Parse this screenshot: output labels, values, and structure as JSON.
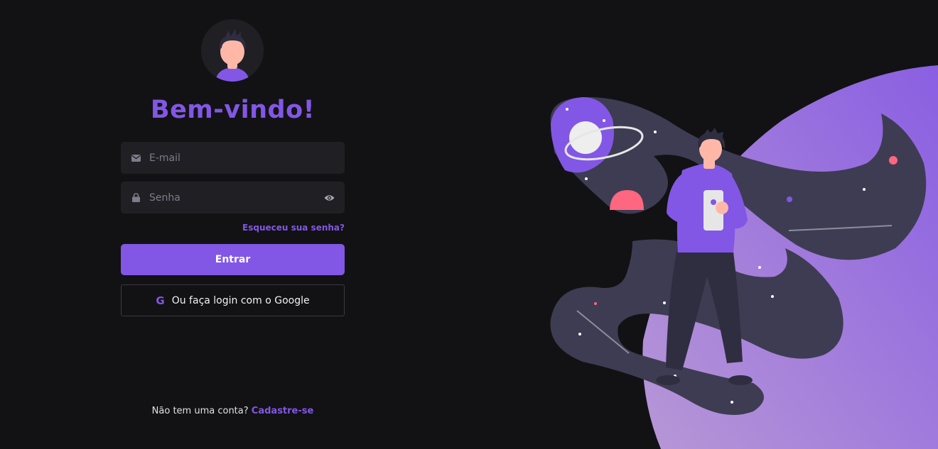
{
  "header": {
    "title": "Bem-vindo!"
  },
  "form": {
    "email": {
      "placeholder": "E-mail",
      "value": ""
    },
    "password": {
      "placeholder": "Senha",
      "value": ""
    },
    "forgot_link": "Esqueceu sua senha?",
    "submit_label": "Entrar",
    "google_label": "Ou faça login com o Google",
    "google_glyph": "G"
  },
  "footer": {
    "prompt": "Não tem uma conta?",
    "signup_link": "Cadastre-se"
  },
  "icons": {
    "email": "envelope-icon",
    "password": "lock-icon",
    "toggle": "eye-icon",
    "google": "google-icon"
  },
  "colors": {
    "background": "#121214",
    "accent": "#8257e5",
    "input_bg": "#202024",
    "text": "#e1e1e6",
    "muted": "#7c7c8a",
    "pink": "#ff6680"
  }
}
